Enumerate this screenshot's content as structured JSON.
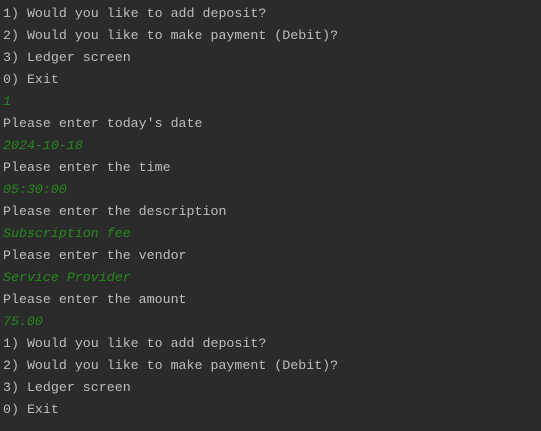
{
  "lines": [
    {
      "type": "out",
      "text": "1) Would you like to add deposit?"
    },
    {
      "type": "out",
      "text": "2) Would you like to make payment (Debit)?"
    },
    {
      "type": "out",
      "text": "3) Ledger screen"
    },
    {
      "type": "out",
      "text": "0) Exit"
    },
    {
      "type": "in",
      "text": "1"
    },
    {
      "type": "out",
      "text": "Please enter today's date"
    },
    {
      "type": "in",
      "text": "2024-10-18"
    },
    {
      "type": "out",
      "text": "Please enter the time"
    },
    {
      "type": "in",
      "text": "05:30:00"
    },
    {
      "type": "out",
      "text": "Please enter the description"
    },
    {
      "type": "in",
      "text": "Subscription fee"
    },
    {
      "type": "out",
      "text": "Please enter the vendor"
    },
    {
      "type": "in",
      "text": "Service Provider"
    },
    {
      "type": "out",
      "text": "Please enter the amount"
    },
    {
      "type": "in",
      "text": "75.00"
    },
    {
      "type": "out",
      "text": "1) Would you like to add deposit?"
    },
    {
      "type": "out",
      "text": "2) Would you like to make payment (Debit)?"
    },
    {
      "type": "out",
      "text": "3) Ledger screen"
    },
    {
      "type": "out",
      "text": "0) Exit"
    }
  ],
  "colors": {
    "background": "#2b2b2b",
    "output": "#bbbdc0",
    "input": "#238a1b"
  }
}
